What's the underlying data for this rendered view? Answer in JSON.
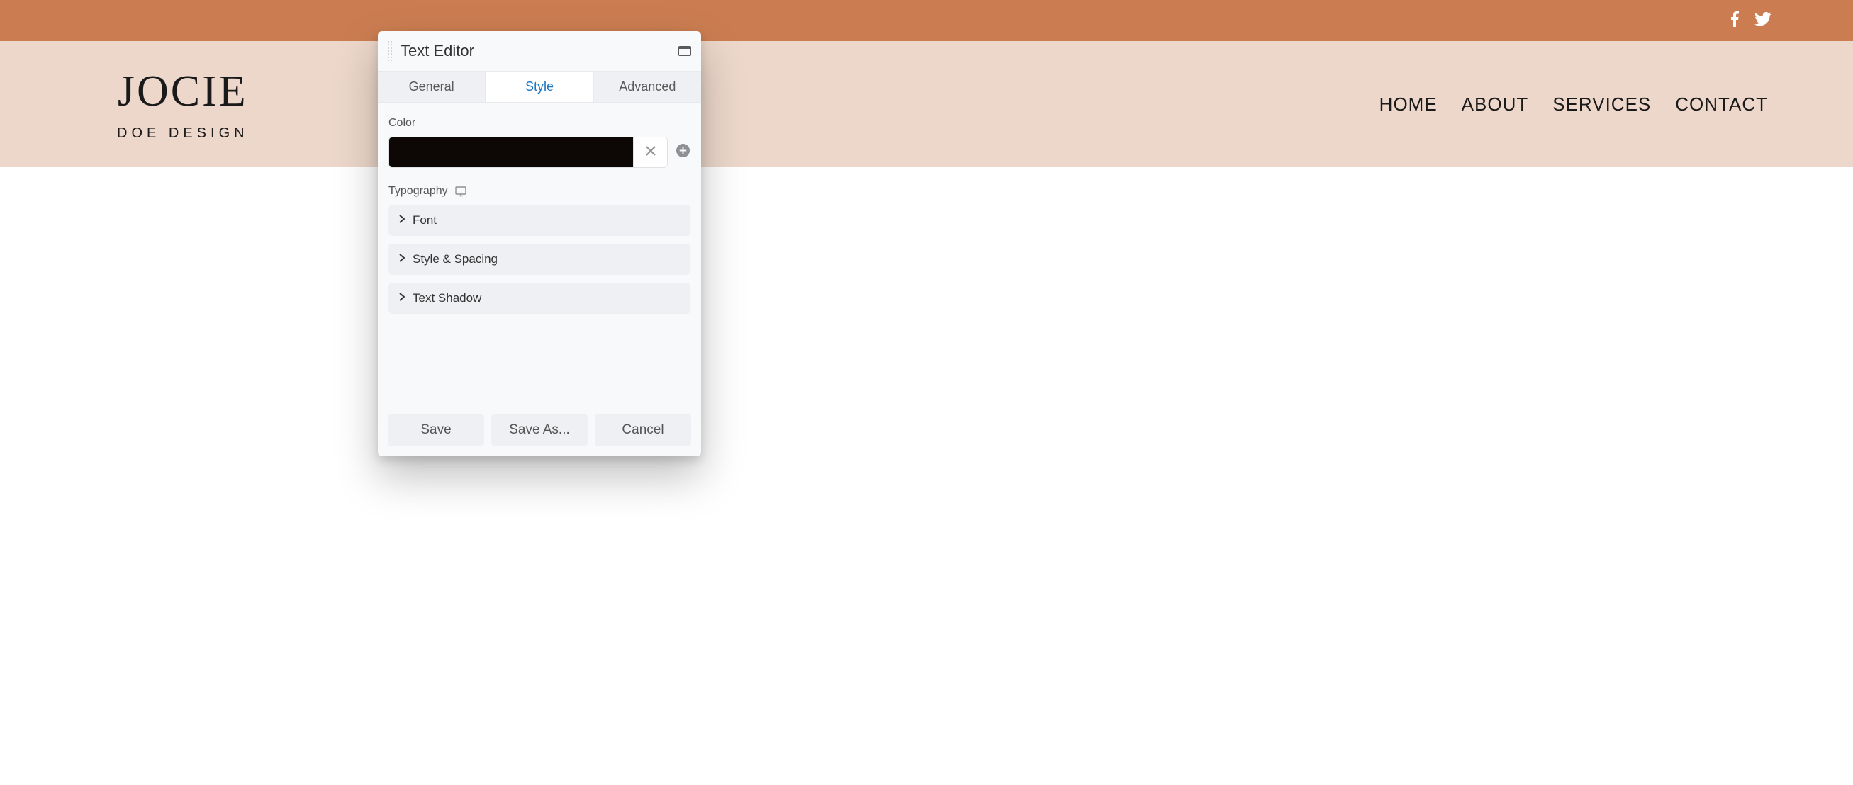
{
  "topbar": {
    "social": [
      "facebook-icon",
      "twitter-icon"
    ]
  },
  "site": {
    "logo_main": "JOCIE",
    "logo_sub": "DOE DESIGN"
  },
  "nav": {
    "items": [
      "HOME",
      "ABOUT",
      "SERVICES",
      "CONTACT"
    ]
  },
  "editor": {
    "title": "Text Editor",
    "tabs": {
      "general": "General",
      "style": "Style",
      "advanced": "Advanced",
      "active": "style"
    },
    "style_panel": {
      "color_label": "Color",
      "color_value": "#0d0805",
      "typography_label": "Typography",
      "accordion": {
        "font": "Font",
        "style_spacing": "Style & Spacing",
        "text_shadow": "Text Shadow"
      }
    },
    "buttons": {
      "save": "Save",
      "save_as": "Save As...",
      "cancel": "Cancel"
    }
  },
  "colors": {
    "brand_orange": "#cb7d51",
    "hero_peach": "#ecd7ca",
    "accent_blue": "#1c75c0"
  }
}
